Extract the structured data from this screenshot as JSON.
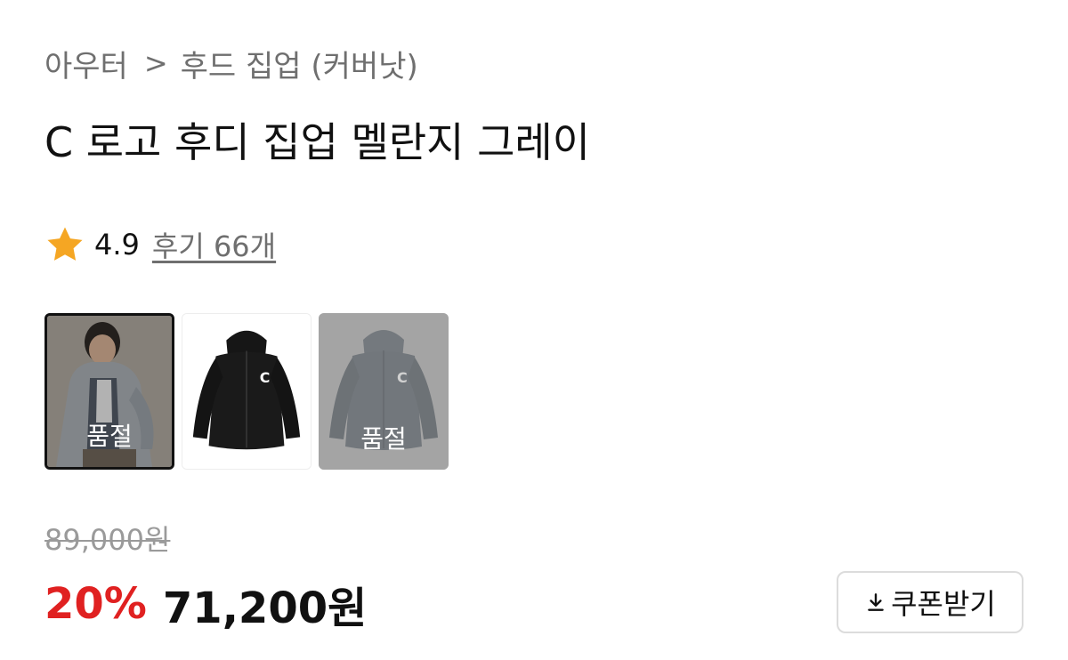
{
  "breadcrumb": {
    "items": [
      "아우터",
      "후드 집업 (커버낫)"
    ],
    "separator": ">"
  },
  "product": {
    "title": "C 로고 후디 집업 멜란지 그레이",
    "rating": "4.9",
    "reviews_link": "후기 66개",
    "star_color": "#F5A623"
  },
  "thumbnails": [
    {
      "image": "model-wearing-gray-hoodie",
      "selected": true,
      "badge": "품절"
    },
    {
      "image": "black-hoodie-zip-up",
      "selected": false,
      "badge": ""
    },
    {
      "image": "gray-hoodie-zip-up",
      "selected": false,
      "badge": "품절"
    }
  ],
  "pricing": {
    "original_price": "89,000원",
    "discount_rate": "20%",
    "sale_price": "71,200원",
    "discount_color": "#E02121"
  },
  "coupon": {
    "label": "쿠폰받기",
    "icon": "download-icon"
  }
}
